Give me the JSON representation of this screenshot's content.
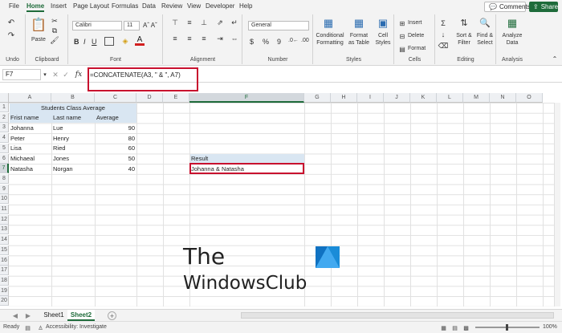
{
  "menu_tabs": [
    "File",
    "Home",
    "Insert",
    "Page Layout",
    "Formulas",
    "Data",
    "Review",
    "View",
    "Developer",
    "Help"
  ],
  "comments_label": "Comments",
  "share_label": "Share",
  "ribbon": {
    "undo_label": "Undo",
    "paste_label": "Paste",
    "clipboard_label": "Clipboard",
    "font_name": "Calibri",
    "font_size": "11",
    "font_label": "Font",
    "alignment_label": "Alignment",
    "number_format": "General",
    "number_label": "Number",
    "conditional_formatting_label": "Conditional Formatting",
    "format_as_table_label": "Format as Table",
    "cell_styles_label": "Cell Styles",
    "styles_label": "Styles",
    "insert_label": "Insert",
    "delete_label": "Delete",
    "format_label": "Format",
    "cells_label": "Cells",
    "sort_filter_label": "Sort & Filter",
    "find_select_label": "Find & Select",
    "editing_label": "Editing",
    "analyze_data_label": "Analyze Data",
    "analysis_label": "Analysis"
  },
  "name_box": "F7",
  "formula": "=CONCATENATE(A3, \" & \", A7)",
  "columns": [
    "A",
    "B",
    "C",
    "D",
    "E",
    "F",
    "G",
    "H",
    "I",
    "J",
    "K",
    "L",
    "M",
    "N",
    "O"
  ],
  "rows": [
    "1",
    "2",
    "3",
    "4",
    "5",
    "6",
    "7",
    "8",
    "9",
    "10",
    "11",
    "12",
    "13",
    "14",
    "15",
    "16",
    "17",
    "18",
    "19",
    "20",
    "21"
  ],
  "sheet": {
    "title": "Students Class Average",
    "headers": [
      "Frist name",
      "Last name",
      "Average"
    ],
    "rows": [
      {
        "first": "Johanna",
        "last": "Lue",
        "avg": "90"
      },
      {
        "first": "Peter",
        "last": "Henry",
        "avg": "80"
      },
      {
        "first": "Lisa",
        "last": "Ried",
        "avg": "60"
      },
      {
        "first": "Michaeal",
        "last": "Jones",
        "avg": "50"
      },
      {
        "first": "Natasha",
        "last": "Norgan",
        "avg": "40"
      }
    ],
    "result_label": "Result",
    "result_value": "Johanna & Natasha"
  },
  "sheet_tabs": [
    "Sheet1",
    "Sheet2"
  ],
  "status": {
    "ready": "Ready",
    "accessibility": "Accessibility: Investigate",
    "zoom": "100%"
  },
  "watermark": {
    "line1": "The",
    "line2": "WindowsClub"
  },
  "colors": {
    "accent": "#1e6b3a",
    "highlight": "#d9e6f2",
    "red_box": "#c8102e"
  }
}
